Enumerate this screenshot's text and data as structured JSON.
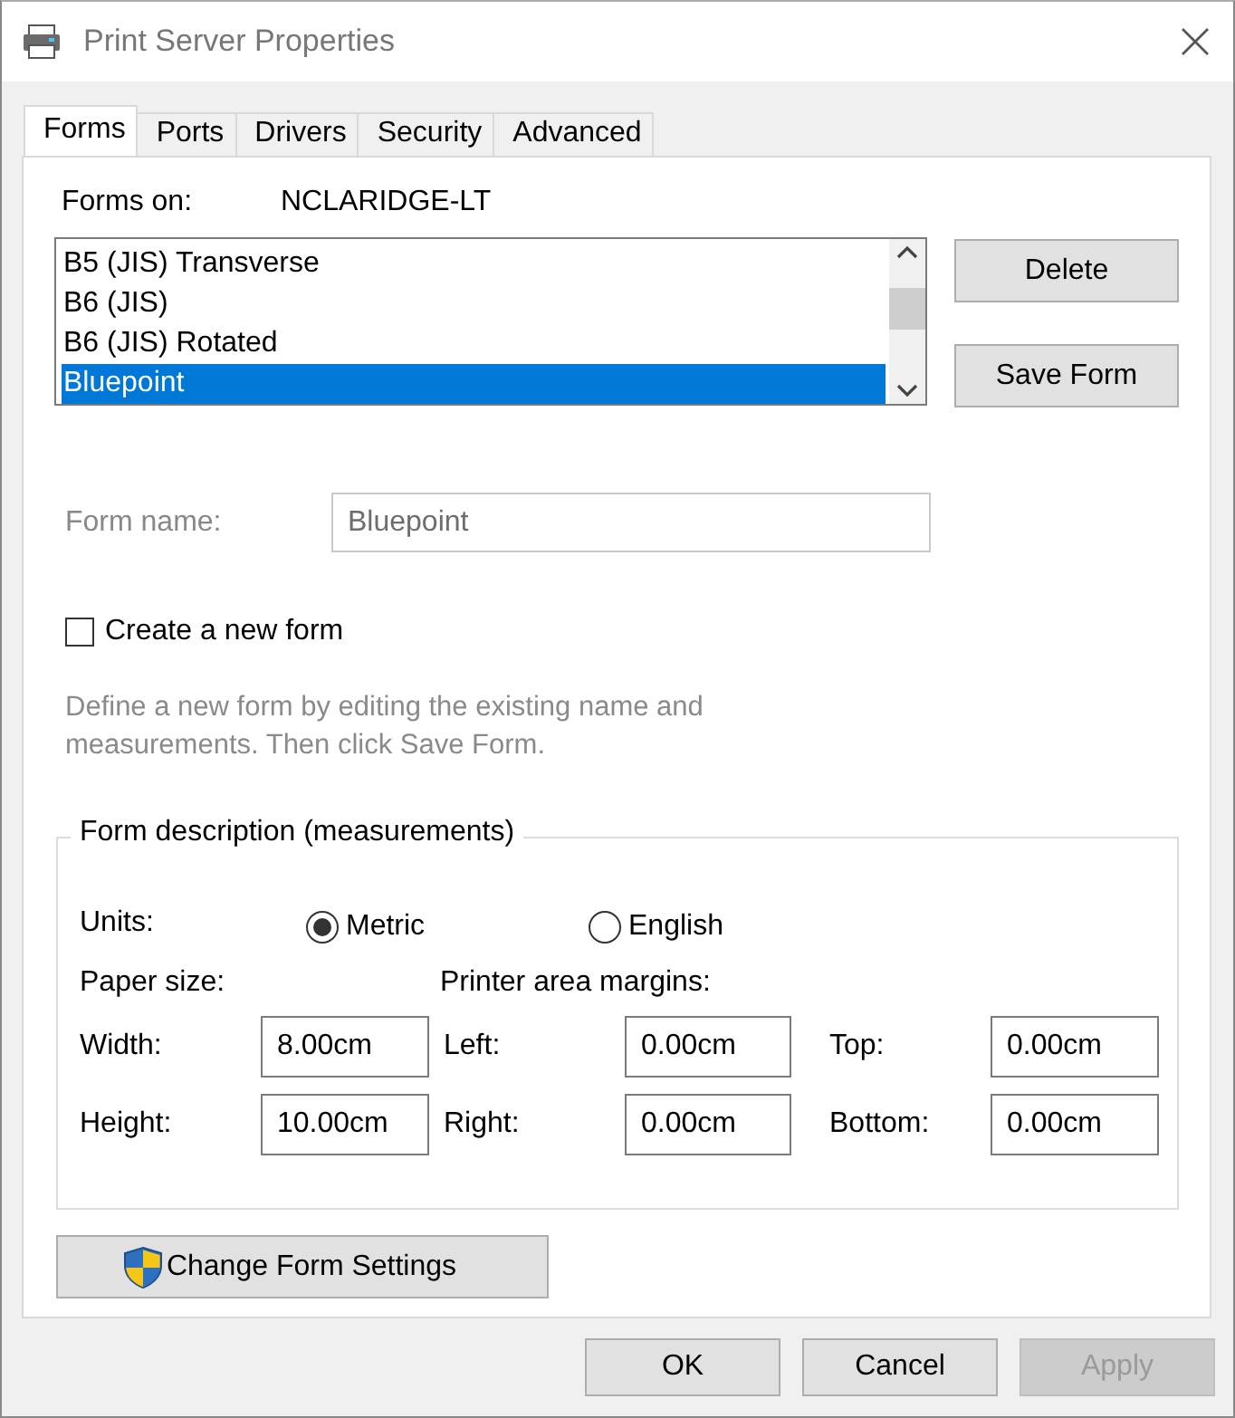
{
  "window": {
    "title": "Print Server Properties"
  },
  "tabs": [
    {
      "label": "Forms",
      "selected": true
    },
    {
      "label": "Ports",
      "selected": false
    },
    {
      "label": "Drivers",
      "selected": false
    },
    {
      "label": "Security",
      "selected": false
    },
    {
      "label": "Advanced",
      "selected": false
    }
  ],
  "forms_on": {
    "label": "Forms on:",
    "server": "NCLARIDGE-LT"
  },
  "forms_list": {
    "items": [
      {
        "label": "B5 (JIS) Transverse",
        "selected": false
      },
      {
        "label": "B6 (JIS)",
        "selected": false
      },
      {
        "label": "B6 (JIS) Rotated",
        "selected": false
      },
      {
        "label": "Bluepoint",
        "selected": true
      }
    ]
  },
  "list_buttons": [
    "Delete",
    "Save Form"
  ],
  "form_name": {
    "label": "Form name:",
    "value": "Bluepoint",
    "disabled": true
  },
  "create_new_form": {
    "label": "Create a new form",
    "checked": false
  },
  "hint": "Define a new form by editing the existing name and measurements. Then click Save Form.",
  "form_description": {
    "title": "Form description (measurements)",
    "units": {
      "label": "Units:",
      "options": [
        {
          "label": "Metric",
          "selected": true
        },
        {
          "label": "English",
          "selected": false
        }
      ]
    },
    "paper_size_label": "Paper size:",
    "margins_label": "Printer area margins:",
    "rows": [
      [
        {
          "label": "Width:",
          "value": "8.00cm"
        },
        {
          "label": "Left:",
          "value": "0.00cm"
        },
        {
          "label": "Top:",
          "value": "0.00cm"
        }
      ],
      [
        {
          "label": "Height:",
          "value": "10.00cm"
        },
        {
          "label": "Right:",
          "value": "0.00cm"
        },
        {
          "label": "Bottom:",
          "value": "0.00cm"
        }
      ]
    ]
  },
  "change_button": "Change Form Settings",
  "dialog_buttons": [
    {
      "label": "OK",
      "disabled": false
    },
    {
      "label": "Cancel",
      "disabled": false
    },
    {
      "label": "Apply",
      "disabled": true
    }
  ]
}
